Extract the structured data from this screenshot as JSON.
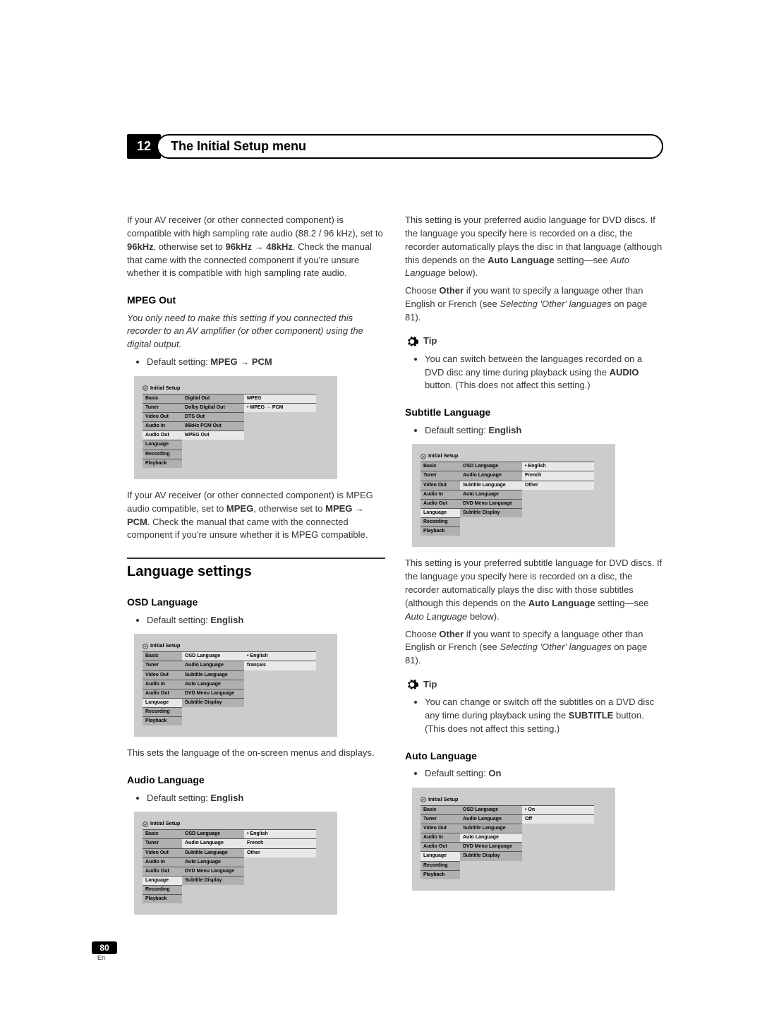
{
  "chapter": {
    "num": "12",
    "title": "The Initial Setup menu"
  },
  "left": {
    "intro": "If your AV receiver (or other connected component) is compatible with high sampling rate audio (88.2 / 96 kHz), set to ",
    "intro_b1": "96kHz",
    "intro_mid": ", otherwise set to ",
    "intro_b2": "96kHz → 48kHz",
    "intro_end": ". Check the manual that came with the connected component if you're unsure whether it is compatible with high sampling rate audio.",
    "mpeg_h": "MPEG Out",
    "mpeg_note": "You only need to make this setting if you connected this recorder to an AV amplifier (or other component) using the digital output.",
    "mpeg_def_pre": "Default setting: ",
    "mpeg_def_b": "MPEG → PCM",
    "mpeg_after_pre": "If your AV receiver (or other connected component) is MPEG audio compatible, set to ",
    "mpeg_after_b1": "MPEG",
    "mpeg_after_mid": ", otherwise set to ",
    "mpeg_after_b2": "MPEG → PCM",
    "mpeg_after_end": ". Check the manual that came with the connected component if you're unsure whether it is MPEG compatible.",
    "lang_h": "Language settings",
    "osd_h": "OSD Language",
    "osd_def_pre": "Default setting: ",
    "osd_def_b": "English",
    "osd_after": "This sets the language of the on-screen menus and displays.",
    "audio_h": "Audio Language",
    "audio_def_pre": "Default setting: ",
    "audio_def_b": "English"
  },
  "right": {
    "audio_p1_pre": "This setting is your preferred audio language for DVD discs. If the language you specify here is recorded on a disc, the recorder automatically plays the disc in that language (although this depends on the ",
    "audio_p1_b": "Auto Language",
    "audio_p1_mid": " setting—see ",
    "audio_p1_i": "Auto Language",
    "audio_p1_end": " below).",
    "audio_p2_pre": "Choose ",
    "audio_p2_b": "Other",
    "audio_p2_mid": " if you want to specify a language other than English or French (see ",
    "audio_p2_i": "Selecting 'Other' languages",
    "audio_p2_end": " on page 81).",
    "tip1_pre": "You can switch between the languages recorded on a DVD disc any time during playback using the ",
    "tip1_b": "AUDIO",
    "tip1_end": " button. (This does not affect this setting.)",
    "sub_h": "Subtitle Language",
    "sub_def_pre": "Default setting: ",
    "sub_def_b": "English",
    "sub_p1_pre": "This setting is your preferred subtitle language for DVD discs. If the language you specify here is recorded on a disc, the recorder automatically plays the disc with those subtitles (although this depends on the ",
    "sub_p1_b": "Auto Language",
    "sub_p1_mid": " setting—see ",
    "sub_p1_i": "Auto Language",
    "sub_p1_end": " below).",
    "sub_p2_pre": "Choose ",
    "sub_p2_b": "Other",
    "sub_p2_mid": " if you want to specify a language other than English or French (see ",
    "sub_p2_i": "Selecting 'Other' languages",
    "sub_p2_end": " on page 81).",
    "tip2_pre": "You can change or switch off the subtitles on a DVD disc any time during playback using the ",
    "tip2_b": "SUBTITLE",
    "tip2_end": " button. (This does not affect this setting.)",
    "auto_h": "Auto Language",
    "auto_def_pre": "Default setting: ",
    "auto_def_b": "On"
  },
  "menus": {
    "title": "Initial Setup",
    "tabs": [
      "Basic",
      "Tuner",
      "Video Out",
      "Audio In",
      "Audio Out",
      "Language",
      "Recording",
      "Playback"
    ],
    "mpeg": {
      "col2": [
        "Digital Out",
        "Dolby Digital Out",
        "DTS Out",
        "96kHz PCM Out",
        "MPEG Out"
      ],
      "col3": [
        "MPEG",
        "MPEG → PCM"
      ],
      "hi_tab": 4,
      "hi_item": 4,
      "sel": 1
    },
    "osd": {
      "col2": [
        "OSD Language",
        "Audio Language",
        "Subtitle Language",
        "Auto Language",
        "DVD Menu Language",
        "Subtitle Display"
      ],
      "col3": [
        "English",
        "français"
      ],
      "hi_tab": 5,
      "hi_item": 0,
      "sel": 0
    },
    "audio": {
      "col2": [
        "OSD Language",
        "Audio Language",
        "Subtitle Language",
        "Auto Language",
        "DVD Menu Language",
        "Subtitle Display"
      ],
      "col3": [
        "English",
        "French",
        "Other"
      ],
      "hi_tab": 5,
      "hi_item": 1,
      "sel": 0
    },
    "sub": {
      "col2": [
        "OSD Language",
        "Audio Language",
        "Subtitle Language",
        "Auto Language",
        "DVD Menu Language",
        "Subtitle Display"
      ],
      "col3": [
        "English",
        "French",
        "Other"
      ],
      "hi_tab": 5,
      "hi_item": 2,
      "sel": 0
    },
    "auto": {
      "col2": [
        "OSD Language",
        "Audio Language",
        "Subtitle Language",
        "Auto Language",
        "DVD Menu Language",
        "Subtitle Display"
      ],
      "col3": [
        "On",
        "Off"
      ],
      "hi_tab": 5,
      "hi_item": 3,
      "sel": 0
    }
  },
  "tip_label": "Tip",
  "page": {
    "num": "80",
    "lang": "En"
  }
}
